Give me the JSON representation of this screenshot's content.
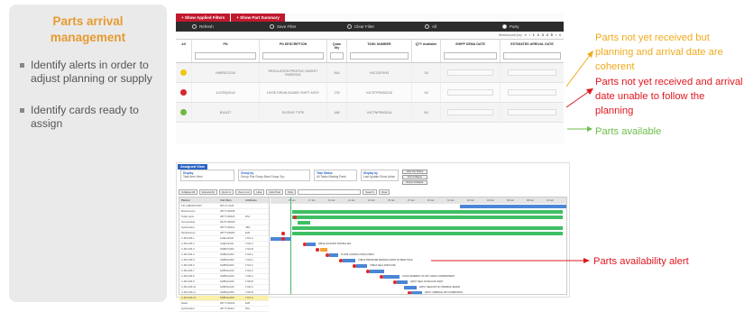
{
  "left_panel": {
    "title": "Parts arrival management",
    "bullets": [
      "Identify alerts in order to adjust planning or supply",
      "Identify cards ready to assign"
    ]
  },
  "table_view": {
    "tabs": [
      "+ Show Applied Filters",
      "+ Show Part Summary"
    ],
    "filterbar": [
      "Refresh",
      "Save Filter",
      "Clear Filter",
      "All",
      "Party"
    ],
    "pager_label": "Items/count (xx)",
    "pager_pages": [
      "«",
      "‹",
      "1",
      "2",
      "3",
      "4",
      "5",
      "›",
      "»"
    ],
    "columns": [
      "All",
      "PN",
      "PN DESCRIPTION",
      "Quan tity",
      "TASK NUMBER",
      "QTY Available",
      "SHIPP DEMA DATE",
      "ESTIMATED ARRIVAL DATE"
    ],
    "rows": [
      {
        "status_color": "#f2c514",
        "pn": "HWRDO1234",
        "desc": "REGULATION PROFILE GASKET HWRDSHL",
        "qty": "N/A",
        "task": "V4C1DFGH3",
        "avail": "1/0"
      },
      {
        "status_color": "#d8262e",
        "pn": "1147RQ001A",
        "desc": "HOSE DRAIN BOARD SHIPT ASSY",
        "qty": "278",
        "task": "V4C9TPRN0012A",
        "avail": "1/0"
      },
      {
        "status_color": "#6cbb3c",
        "pn": "B10427",
        "desc": "SLEEVE TYPE",
        "qty": "188",
        "task": "V4CTNPRN001A",
        "avail": "0/0"
      }
    ]
  },
  "gantt_view": {
    "title": "Assigned View",
    "option_groups": [
      {
        "legend": "Display",
        "options": "Task Item View"
      },
      {
        "legend": "Group by",
        "options": "Group Pos Group Bars Group Grp"
      },
      {
        "legend": "Task Status",
        "options": "All Tasks Missing Parts"
      },
      {
        "legend": "Display by",
        "options": "Last Update Show Arrive"
      }
    ],
    "side_buttons": [
      "Hide the Filters",
      "Full Collapse",
      "Reset Collapse"
    ],
    "toolbar": [
      "Collapse All",
      "Expand All",
      "Zoom in",
      "Zoom out",
      "Hide",
      "Hide Past",
      "Filter",
      "Search",
      "Clear"
    ],
    "left_header": [
      "Planner",
      "Unit Parts",
      "Attributes",
      ""
    ],
    "left_rows": [
      [
        "TIN LABORATORY",
        "WP-07-1029",
        "",
        ""
      ],
      [
        "Maintenance",
        "WP77100038",
        "",
        ""
      ],
      [
        "Outlet parts",
        "WP77100025",
        "RSL",
        ""
      ],
      [
        "Scoutparade",
        "WH77100026",
        "",
        ""
      ],
      [
        "Hydrostatics",
        "WP77100041",
        "ABC",
        ""
      ],
      [
        "PartRoutines",
        "WP77100084",
        "ELB",
        ""
      ],
      [
        "C-MS-006-1",
        "SHELF3A00",
        "1701-A",
        ""
      ],
      [
        "C-MS-006-2",
        "SHELF3A00",
        "1702-A",
        ""
      ],
      [
        "C-MS-006-3",
        "NWB27A000",
        "1702-B",
        ""
      ],
      [
        "C-MS-006-4",
        "NWB27A000",
        "1703-A",
        ""
      ],
      [
        "C-MS-006-5",
        "NWB00A000",
        "1703-A",
        ""
      ],
      [
        "C-MS-006-6",
        "NWB00A000",
        "1704-C",
        ""
      ],
      [
        "C-MS-006-7",
        "NWB31A010",
        "1704-C",
        ""
      ],
      [
        "C-MS-006-8",
        "NWB31A020",
        "1705-A",
        ""
      ],
      [
        "C-MS-006-9",
        "NWB31A030",
        "1705-B",
        ""
      ],
      [
        "C-MS-006-10",
        "NWB31A040",
        "1706-A",
        ""
      ],
      [
        "C-MS-006-11",
        "NWB31A050",
        "1706-B",
        ""
      ],
      [
        "C-MS-006-12",
        "NWB31A060",
        "1707-A",
        ""
      ],
      [
        "Retail",
        "WP77100102",
        "ELB",
        ""
      ],
      [
        "Hydrostatics",
        "WP77100111",
        "RSL",
        ""
      ]
    ],
    "timeline_labels": [
      "15 Jan",
      "17 Jan",
      "19 Jan",
      "21 Jan",
      "23 Jan",
      "25 Jan",
      "27 Jan",
      "29 Jan",
      "31 Jan",
      "02 Feb",
      "04 Feb",
      "06 Feb",
      "08 Feb",
      "10 Feb",
      "12 Feb"
    ],
    "bar_labels": [
      "DRIVE LOCATION TESTING SET",
      "FLOOR LOADING CHAIN CHECK",
      "CHECK PRESSURE SENSOR & RATE OF REAR HOLD",
      "CHECK SEAL SUB PLATE",
      "ATLAS ASSEMBLY OF AFT CARGO COMPARTMENT",
      "APPLY SEAL ON SILICON JOINT",
      "APPLY SEALANT OF CHEMICAL SEAMS",
      "APPLY CHEMICAL ANTI-CORROSION"
    ]
  },
  "annotations": {
    "orange": "Parts not yet received but planning and arrival date are coherent",
    "red": "Parts not yet received and arrival date unable to follow the planning",
    "green": "Parts available",
    "alert": "Parts availability alert"
  },
  "colors": {
    "accent_orange": "#f0ab1b",
    "accent_red": "#e0171f",
    "accent_green": "#6cbf4a",
    "tab_red": "#c0182d",
    "gantt_blue": "#2b64c5"
  }
}
